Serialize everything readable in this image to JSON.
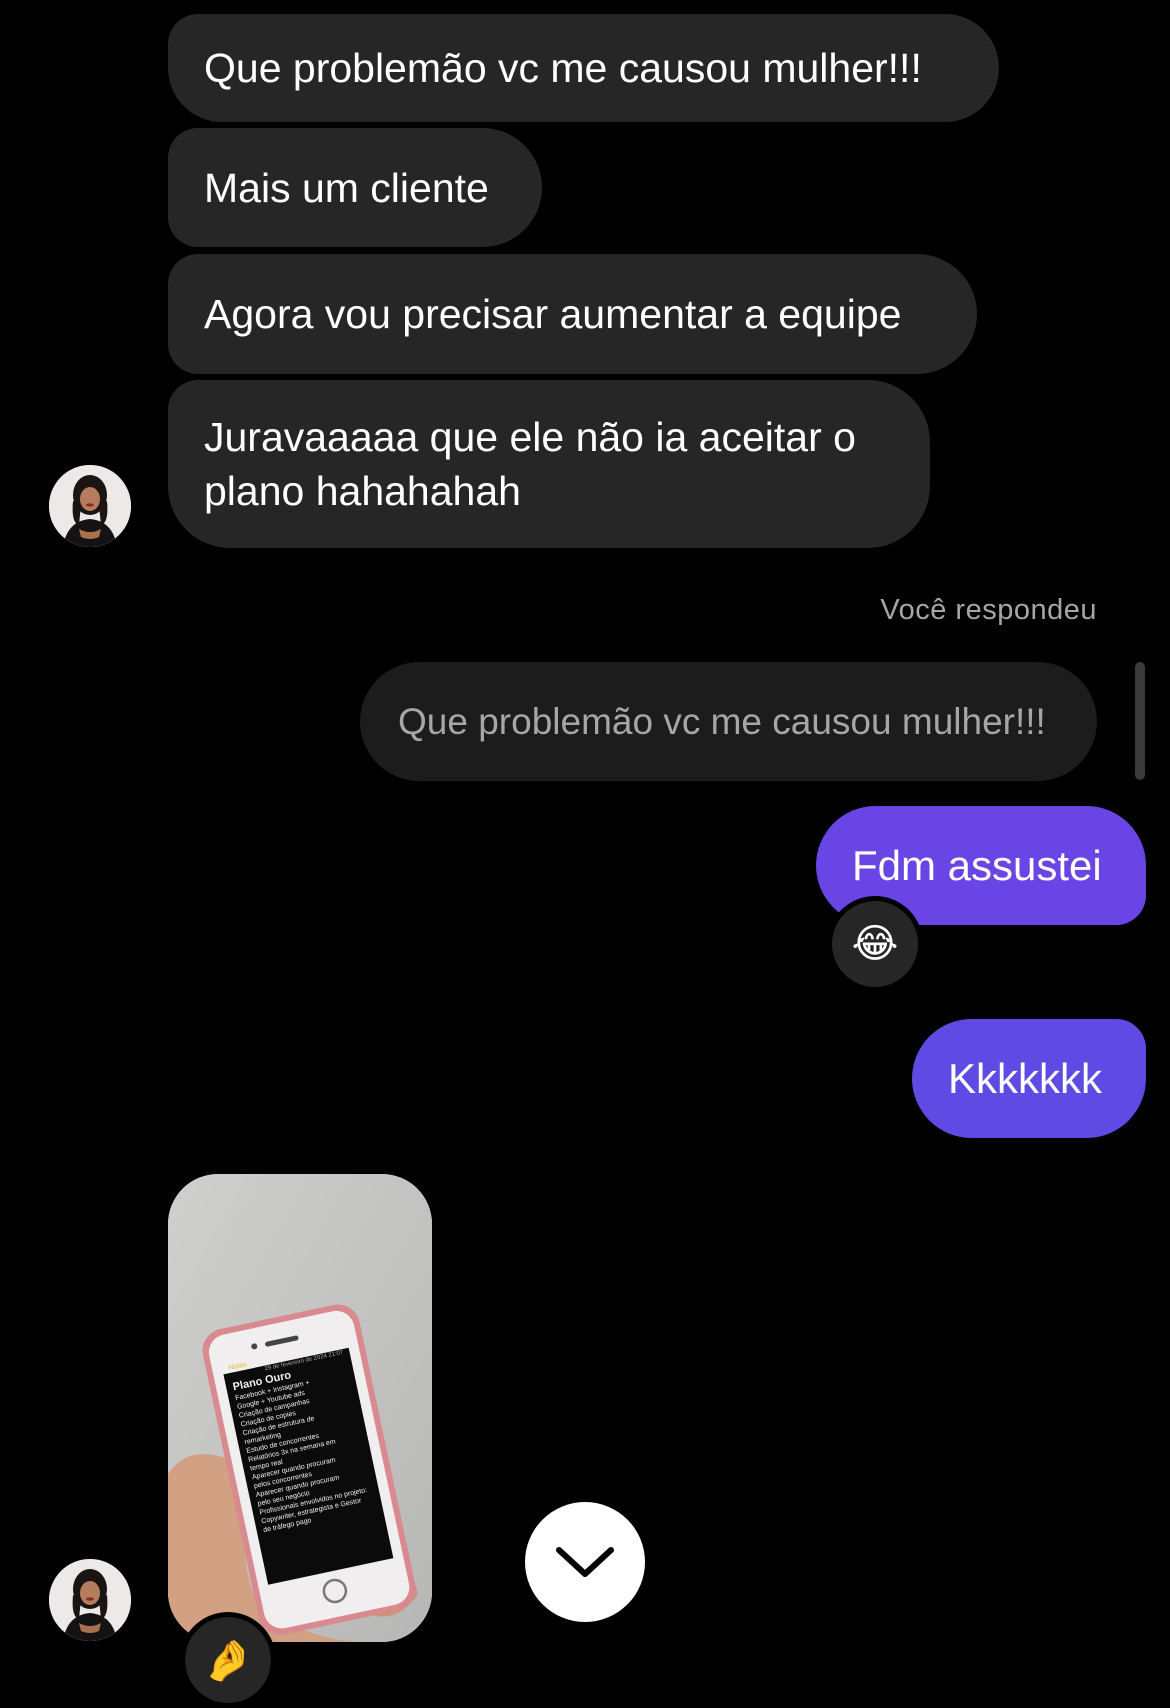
{
  "thread": {
    "incoming_group_1": [
      {
        "text": "Que problemão vc me causou mulher!!!"
      },
      {
        "text": "Mais um cliente"
      },
      {
        "text": "Agora vou precisar aumentar a equipe"
      },
      {
        "line1": "Juravaaaaa que ele não ia aceitar o",
        "line2": "plano hahahahah"
      }
    ],
    "reply_label": "Você respondeu",
    "quoted_message": "Que problemão vc me causou mulher!!!",
    "outgoing": [
      {
        "text": "Fdm assustei",
        "reaction": "😂"
      },
      {
        "text": "Kkkkkkk"
      }
    ],
    "media_reaction": "🤌",
    "phone_note": {
      "back_label": "Notas",
      "date": "29 de fevereiro de 2024 21:07",
      "title": "Plano Ouro",
      "items": [
        "Facebook + Instagram +",
        "Google + Youtube ads",
        "Criação de campanhas",
        "Criação de copies",
        "Criação de estrutura de",
        "remarketing",
        "Estudo de concorrentes",
        "Relatórios 3x na semana em",
        "tempo real",
        "Aparecer quando procuram",
        "pelos concorrentes",
        "Aparecer quando procuram",
        "pelo seu negócio",
        "Profissionais envolvidos no projeto:",
        "Copywriter, estrategista e Gestor",
        "de tráfego pago"
      ]
    }
  },
  "colors": {
    "background": "#000000",
    "incoming_bubble": "#262626",
    "outgoing_bubble": "#6a45e6",
    "quoted_bubble": "#1c1c1c",
    "muted_text": "#a6a6a6"
  },
  "icons": {
    "scroll_down": "chevron-down-icon",
    "avatar": "profile-photo"
  }
}
